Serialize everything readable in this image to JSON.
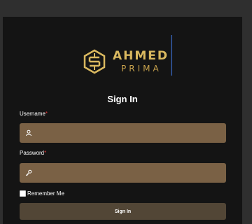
{
  "brand": {
    "name": "AHMED",
    "subtitle": "PRIMA",
    "logo_icon": "brand-logo-icon",
    "gold": "#d9b85f",
    "divider_color": "#2c4b86"
  },
  "form": {
    "title": "Sign In",
    "username": {
      "label": "Username",
      "required_mark": "*",
      "icon": "user-icon",
      "value": "",
      "placeholder": ""
    },
    "password": {
      "label": "Password",
      "required_mark": "*",
      "icon": "key-icon",
      "value": "",
      "placeholder": ""
    },
    "remember": {
      "label": "Remember Me",
      "checked": false
    },
    "submit_label": "Sign In"
  },
  "colors": {
    "background": "#2f2f2f",
    "panel": "#141414",
    "field": "#7a6145",
    "button": "#524636",
    "required": "#e23a3a"
  }
}
